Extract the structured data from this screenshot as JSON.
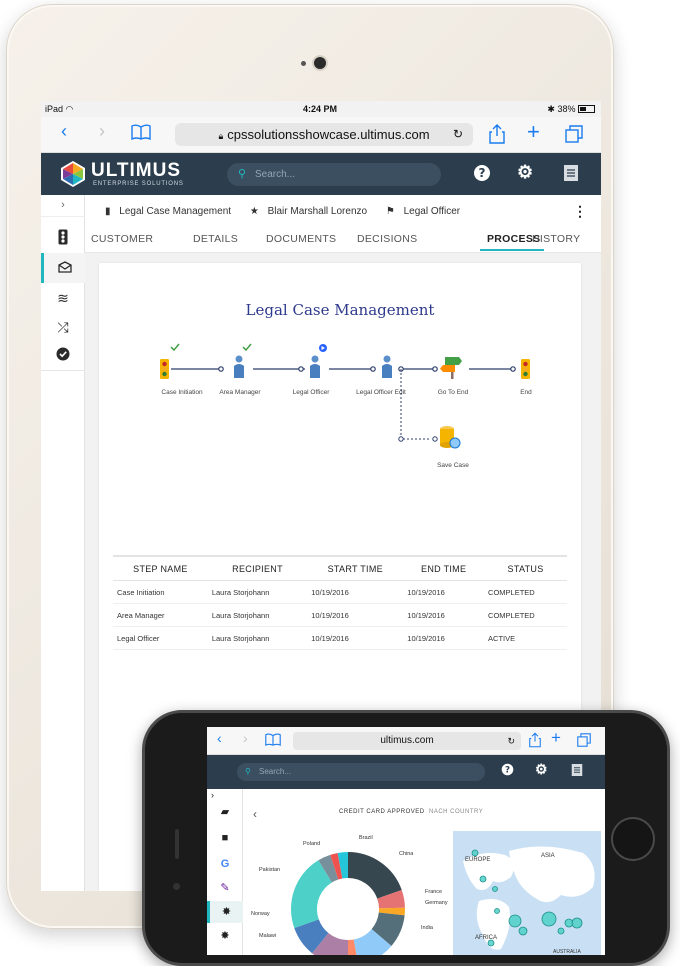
{
  "ipad": {
    "status": {
      "device": "iPad",
      "time": "4:24 PM",
      "battery": "38%"
    },
    "browser": {
      "url": "cpssolutionsshowcase.ultimus.com"
    },
    "app": {
      "brand": "ULTIMUS",
      "brand_sub": "ENTERPRISE SOLUTIONS",
      "search_placeholder": "Search...",
      "icons": [
        "help-icon",
        "settings-icon",
        "menu-icon"
      ]
    },
    "sidebar": {
      "expand_icon": "chevron-right-icon",
      "items": [
        {
          "icon": "traffic-light-icon",
          "active": false
        },
        {
          "icon": "inbox-icon",
          "active": true
        },
        {
          "icon": "layers-icon",
          "active": false
        },
        {
          "icon": "shuffle-icon",
          "active": false
        },
        {
          "icon": "check-circle-icon",
          "active": false
        }
      ]
    },
    "context": {
      "process_name": "Legal Case Management",
      "user": "Blair Marshall Lorenzo",
      "role": "Legal Officer"
    },
    "tabs": [
      {
        "label": "CUSTOMER"
      },
      {
        "label": "DETAILS"
      },
      {
        "label": "DOCUMENTS"
      },
      {
        "label": "DECISIONS"
      },
      {
        "label": "PROCESS",
        "active": true
      },
      {
        "label": "HISTORY"
      }
    ],
    "process": {
      "title": "Legal Case Management",
      "nodes": [
        {
          "label": "Case Initiation",
          "status": "completed"
        },
        {
          "label": "Area Manager",
          "status": "completed"
        },
        {
          "label": "Legal Officer",
          "status": "active"
        },
        {
          "label": "Legal Officer Edit",
          "status": "pending"
        },
        {
          "label": "Go To End",
          "status": "pending"
        },
        {
          "label": "End",
          "status": "pending"
        },
        {
          "label": "Save Case",
          "status": "pending"
        }
      ]
    },
    "steps_table": {
      "columns": [
        "STEP NAME",
        "RECIPIENT",
        "START TIME",
        "END TIME",
        "STATUS"
      ],
      "rows": [
        [
          "Case Initiation",
          "Laura Storjohann",
          "10/19/2016",
          "10/19/2016",
          "COMPLETED"
        ],
        [
          "Area Manager",
          "Laura Storjohann",
          "10/19/2016",
          "10/19/2016",
          "COMPLETED"
        ],
        [
          "Legal Officer",
          "Laura Storjohann",
          "10/19/2016",
          "10/19/2016",
          "ACTIVE"
        ]
      ]
    }
  },
  "iphone": {
    "browser": {
      "url": "ultimus.com"
    },
    "app": {
      "search_placeholder": "Search..."
    },
    "chart_header": {
      "title": "CREDIT CARD APPROVED",
      "subtitle": "NACH COUNTRY"
    },
    "donut_labels": [
      "Brazil",
      "China",
      "Poland",
      "Pakistan",
      "France",
      "Germany",
      "Norway",
      "India",
      "Malawi"
    ],
    "map_labels": [
      "EUROPE",
      "ASIA",
      "AFRICA",
      "AUSTRALIA"
    ]
  },
  "colors": {
    "appbar": "#2c3e4e",
    "accent": "#21b7c0",
    "title_blue": "#2e3a8c"
  }
}
